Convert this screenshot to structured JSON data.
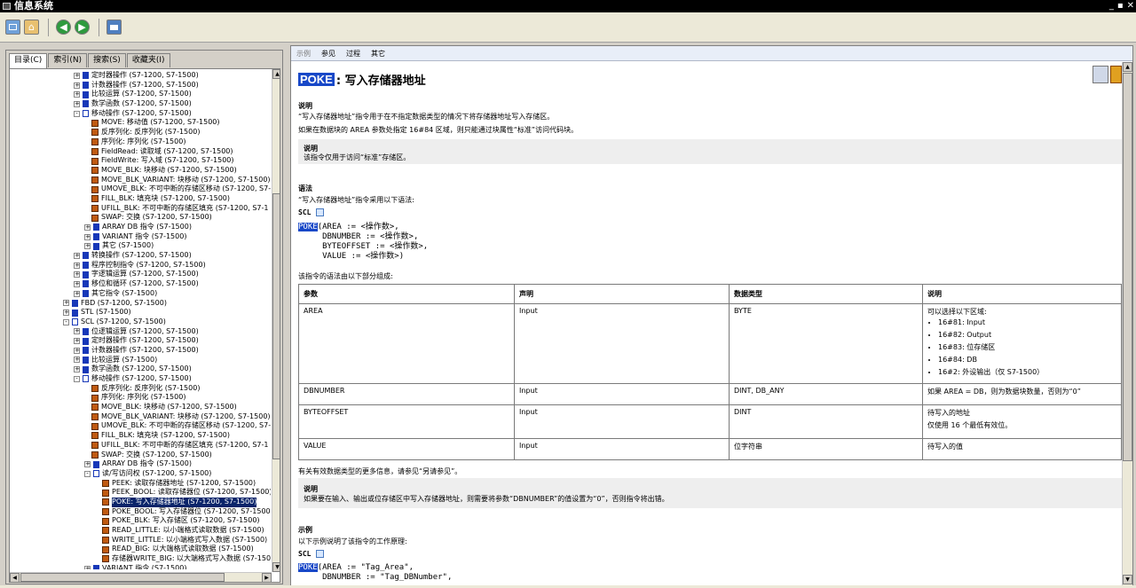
{
  "window": {
    "title": "信息系统",
    "controls": [
      "_",
      "▪",
      "✕"
    ]
  },
  "left_tabs": [
    "目录(C)",
    "索引(N)",
    "搜索(S)",
    "收藏夹(I)"
  ],
  "tree": [
    {
      "indent": 72,
      "exp": "+",
      "icon": "book",
      "label": "定时器操作 (S7-1200, S7-1500)"
    },
    {
      "indent": 72,
      "exp": "+",
      "icon": "book",
      "label": "计数器操作 (S7-1200, S7-1500)"
    },
    {
      "indent": 72,
      "exp": "+",
      "icon": "book",
      "label": "比较运算 (S7-1200, S7-1500)"
    },
    {
      "indent": 72,
      "exp": "+",
      "icon": "book",
      "label": "数学函数 (S7-1200, S7-1500)"
    },
    {
      "indent": 72,
      "exp": "-",
      "icon": "open",
      "label": "移动操作 (S7-1200, S7-1500)"
    },
    {
      "indent": 92,
      "exp": "",
      "icon": "page",
      "label": "MOVE: 移动值 (S7-1200, S7-1500)"
    },
    {
      "indent": 92,
      "exp": "",
      "icon": "page",
      "label": "反序列化: 反序列化 (S7-1500)"
    },
    {
      "indent": 92,
      "exp": "",
      "icon": "page",
      "label": "序列化: 序列化 (S7-1500)"
    },
    {
      "indent": 92,
      "exp": "",
      "icon": "page",
      "label": "FieldRead: 读取域 (S7-1200, S7-1500)"
    },
    {
      "indent": 92,
      "exp": "",
      "icon": "page",
      "label": "FieldWrite: 写入域 (S7-1200, S7-1500)"
    },
    {
      "indent": 92,
      "exp": "",
      "icon": "page",
      "label": "MOVE_BLK: 块移动 (S7-1200, S7-1500)"
    },
    {
      "indent": 92,
      "exp": "",
      "icon": "page",
      "label": "MOVE_BLK_VARIANT: 块移动 (S7-1200, S7-1500)"
    },
    {
      "indent": 92,
      "exp": "",
      "icon": "page",
      "label": "UMOVE_BLK: 不可中断的存储区移动 (S7-1200, S7-1"
    },
    {
      "indent": 92,
      "exp": "",
      "icon": "page",
      "label": "FILL_BLK: 填充块 (S7-1200, S7-1500)"
    },
    {
      "indent": 92,
      "exp": "",
      "icon": "page",
      "label": "UFILL_BLK: 不可中断的存储区填充 (S7-1200, S7-1"
    },
    {
      "indent": 92,
      "exp": "",
      "icon": "page",
      "label": "SWAP: 交换 (S7-1200, S7-1500)"
    },
    {
      "indent": 84,
      "exp": "+",
      "icon": "book",
      "label": "ARRAY DB 指令 (S7-1500)"
    },
    {
      "indent": 84,
      "exp": "+",
      "icon": "book",
      "label": "VARIANT 指令 (S7-1500)"
    },
    {
      "indent": 84,
      "exp": "+",
      "icon": "book",
      "label": "其它 (S7-1500)"
    },
    {
      "indent": 72,
      "exp": "+",
      "icon": "book",
      "label": "转换操作 (S7-1200, S7-1500)"
    },
    {
      "indent": 72,
      "exp": "+",
      "icon": "book",
      "label": "程序控制指令 (S7-1200, S7-1500)"
    },
    {
      "indent": 72,
      "exp": "+",
      "icon": "book",
      "label": "字逻辑运算 (S7-1200, S7-1500)"
    },
    {
      "indent": 72,
      "exp": "+",
      "icon": "book",
      "label": "移位和循环 (S7-1200, S7-1500)"
    },
    {
      "indent": 72,
      "exp": "+",
      "icon": "book",
      "label": "其它指令 (S7-1500)"
    },
    {
      "indent": 60,
      "exp": "+",
      "icon": "book",
      "label": "FBD (S7-1200, S7-1500)"
    },
    {
      "indent": 60,
      "exp": "+",
      "icon": "book",
      "label": "STL (S7-1500)"
    },
    {
      "indent": 60,
      "exp": "-",
      "icon": "open",
      "label": "SCL (S7-1200, S7-1500)"
    },
    {
      "indent": 72,
      "exp": "+",
      "icon": "book",
      "label": "位逻辑运算 (S7-1200, S7-1500)"
    },
    {
      "indent": 72,
      "exp": "+",
      "icon": "book",
      "label": "定时器操作 (S7-1200, S7-1500)"
    },
    {
      "indent": 72,
      "exp": "+",
      "icon": "book",
      "label": "计数器操作 (S7-1200, S7-1500)"
    },
    {
      "indent": 72,
      "exp": "+",
      "icon": "book",
      "label": "比较运算 (S7-1500)"
    },
    {
      "indent": 72,
      "exp": "+",
      "icon": "book",
      "label": "数学函数 (S7-1200, S7-1500)"
    },
    {
      "indent": 72,
      "exp": "-",
      "icon": "open",
      "label": "移动操作 (S7-1200, S7-1500)"
    },
    {
      "indent": 92,
      "exp": "",
      "icon": "page",
      "label": "反序列化: 反序列化 (S7-1500)"
    },
    {
      "indent": 92,
      "exp": "",
      "icon": "page",
      "label": "序列化: 序列化 (S7-1500)"
    },
    {
      "indent": 92,
      "exp": "",
      "icon": "page",
      "label": "MOVE_BLK: 块移动 (S7-1200, S7-1500)"
    },
    {
      "indent": 92,
      "exp": "",
      "icon": "page",
      "label": "MOVE_BLK_VARIANT: 块移动 (S7-1200, S7-1500)"
    },
    {
      "indent": 92,
      "exp": "",
      "icon": "page",
      "label": "UMOVE_BLK: 不可中断的存储区移动 (S7-1200, S7-1"
    },
    {
      "indent": 92,
      "exp": "",
      "icon": "page",
      "label": "FILL_BLK: 填充块 (S7-1200, S7-1500)"
    },
    {
      "indent": 92,
      "exp": "",
      "icon": "page",
      "label": "UFILL_BLK: 不可中断的存储区填充 (S7-1200, S7-1"
    },
    {
      "indent": 92,
      "exp": "",
      "icon": "page",
      "label": "SWAP: 交换 (S7-1200, S7-1500)"
    },
    {
      "indent": 84,
      "exp": "+",
      "icon": "book",
      "label": "ARRAY DB 指令 (S7-1500)"
    },
    {
      "indent": 84,
      "exp": "-",
      "icon": "open",
      "label": "读/写访问权 (S7-1200, S7-1500)"
    },
    {
      "indent": 104,
      "exp": "",
      "icon": "page",
      "label": "PEEK: 读取存储器地址 (S7-1200, S7-1500)"
    },
    {
      "indent": 104,
      "exp": "",
      "icon": "page",
      "label": "PEEK_BOOL: 读取存储器位 (S7-1200, S7-1500)"
    },
    {
      "indent": 104,
      "exp": "",
      "icon": "page",
      "label": "POKE: 写入存储器地址 (S7-1200, S7-1500)",
      "selected": true
    },
    {
      "indent": 104,
      "exp": "",
      "icon": "page",
      "label": "POKE_BOOL: 写入存储器位 (S7-1200, S7-1500)"
    },
    {
      "indent": 104,
      "exp": "",
      "icon": "page",
      "label": "POKE_BLK: 写入存储区 (S7-1200, S7-1500)"
    },
    {
      "indent": 104,
      "exp": "",
      "icon": "page",
      "label": "READ_LITTLE: 以小端格式读取数据 (S7-1500)"
    },
    {
      "indent": 104,
      "exp": "",
      "icon": "page",
      "label": "WRITE_LITTLE: 以小端格式写入数据 (S7-1500)"
    },
    {
      "indent": 104,
      "exp": "",
      "icon": "page",
      "label": "READ_BIG: 以大端格式读取数据 (S7-1500)"
    },
    {
      "indent": 104,
      "exp": "",
      "icon": "page",
      "label": "存储器WRITE_BIG: 以大端格式写入数据 (S7-1500"
    },
    {
      "indent": 84,
      "exp": "+",
      "icon": "book",
      "label": "VARIANT 指令 (S7-1500)"
    }
  ],
  "right_tabs": [
    "示例",
    "参见",
    "过程",
    "其它"
  ],
  "page": {
    "title_keyword": "POKE",
    "title_rest": ":  写入存储器地址",
    "desc_heading": "说明",
    "desc_line1": "“写入存储器地址”指令用于在不指定数据类型的情况下将存储器地址写入存储区。",
    "desc_line2": "如果在数据块的 AREA 参数处指定 16#84 区域，则只能通过块属性“标准”访问代码块。",
    "note1_heading": "说明",
    "note1_text": "该指令仅用于访问“标准”存储区。",
    "syntax_heading": "语法",
    "syntax_intro": "“写入存储器地址”指令采用以下语法:",
    "scl_label": "SCL",
    "code_kw": "POKE",
    "code_line1": "(AREA := <操作数>,",
    "code_line2": "     DBNUMBER := <操作数>,",
    "code_line3": "     BYTEOFFSET := <操作数>,",
    "code_line4": "     VALUE := <操作数>)",
    "table_intro": "该指令的语法由以下部分组成:",
    "table": {
      "headers": [
        "参数",
        "声明",
        "数据类型",
        "说明"
      ],
      "rows": [
        {
          "param": "AREA",
          "decl": "Input",
          "type": "BYTE",
          "desc": "可以选择以下区域:",
          "items": [
            "16#81: Input",
            "16#82: Output",
            "16#83: 位存储区",
            "16#84: DB",
            "16#2: 外设输出（仅 S7-1500）"
          ]
        },
        {
          "param": "DBNUMBER",
          "decl": "Input",
          "type": "DINT, DB_ANY",
          "desc": "如果 AREA = DB，则为数据块数量，否则为“0”"
        },
        {
          "param": "BYTEOFFSET",
          "decl": "Input",
          "type": "DINT",
          "desc": "待写入的地址",
          "desc2": "仅使用 16 个最低有效位。"
        },
        {
          "param": "VALUE",
          "decl": "Input",
          "type": "位字符串",
          "desc": "待写入的值"
        }
      ]
    },
    "more_info": "有关有效数据类型的更多信息，请参见“另请参见”。",
    "note2_heading": "说明",
    "note2_text": "如果要在输入、输出或位存储区中写入存储器地址，则需要将参数“DBNUMBER”的值设置为“0”，否则指令将出错。",
    "example_heading": "示例",
    "example_intro": "以下示例说明了该指令的工作原理:",
    "ex_scl_label": "SCL",
    "ex_kw": "POKE",
    "ex_line1": "(AREA := \"Tag_Area\",",
    "ex_line2": "     DBNUMBER := \"Tag_DBNumber\","
  }
}
